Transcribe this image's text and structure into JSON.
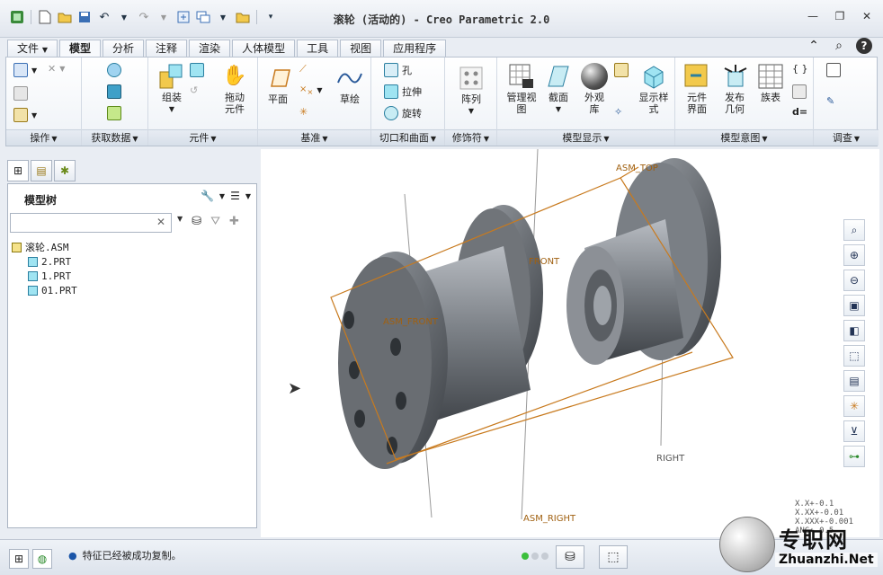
{
  "window": {
    "title": "滚轮 (活动的) - Creo Parametric 2.0"
  },
  "tabs": [
    {
      "label": "文件",
      "active": false
    },
    {
      "label": "模型",
      "active": true
    },
    {
      "label": "分析",
      "active": false
    },
    {
      "label": "注释",
      "active": false
    },
    {
      "label": "渲染",
      "active": false
    },
    {
      "label": "人体模型",
      "active": false
    },
    {
      "label": "工具",
      "active": false
    },
    {
      "label": "视图",
      "active": false
    },
    {
      "label": "应用程序",
      "active": false
    }
  ],
  "ribbon": {
    "groups": {
      "operations": "操作",
      "get_data": "获取数据",
      "component": "元件",
      "datum": "基准",
      "cut_surface": "切口和曲面",
      "modifiers": "修饰符",
      "model_display": "模型显示",
      "model_intent": "模型意图",
      "investigate": "调查"
    },
    "buttons": {
      "assemble": "组装",
      "drag_line1": "拖动",
      "drag_line2": "元件",
      "plane": "平面",
      "sketch": "草绘",
      "hole": "孔",
      "extrude": "拉伸",
      "revolve": "旋转",
      "pattern": "阵列",
      "manage_views_line1": "管理视",
      "manage_views_line2": "图",
      "section": "截面",
      "appearance_line1": "外观",
      "appearance_line2": "库",
      "display_style_line1": "显示样",
      "display_style_line2": "式",
      "component_interface_line1": "元件",
      "component_interface_line2": "界面",
      "publish_geometry_line1": "发布",
      "publish_geometry_line2": "几何",
      "family_table": "族表",
      "relations_symbol": "d="
    }
  },
  "model_tree": {
    "title": "模型树",
    "search_value": "",
    "items": [
      {
        "label": "滚轮.ASM",
        "type": "asm"
      },
      {
        "label": "2.PRT",
        "type": "prt"
      },
      {
        "label": "1.PRT",
        "type": "prt"
      },
      {
        "label": "01.PRT",
        "type": "prt"
      }
    ]
  },
  "viewport": {
    "datum_labels": {
      "asm_top": "ASM_TOP",
      "front": "FRONT",
      "asm_front": "ASM_FRONT",
      "right": "RIGHT",
      "asm_right": "ASM_RIGHT"
    },
    "tolerances": [
      "X.X+-0.1",
      "X.XX+-0.01",
      "X.XXX+-0.001",
      "ANG+-0.5"
    ]
  },
  "status": {
    "message": "特征已经被成功复制。"
  },
  "watermark": {
    "brand": "专职网",
    "url": "Zhuanzhi.Net"
  },
  "colors": {
    "accent": "#1a55a8",
    "datum_plane": "#c87a1e",
    "model": "#6d7278"
  }
}
